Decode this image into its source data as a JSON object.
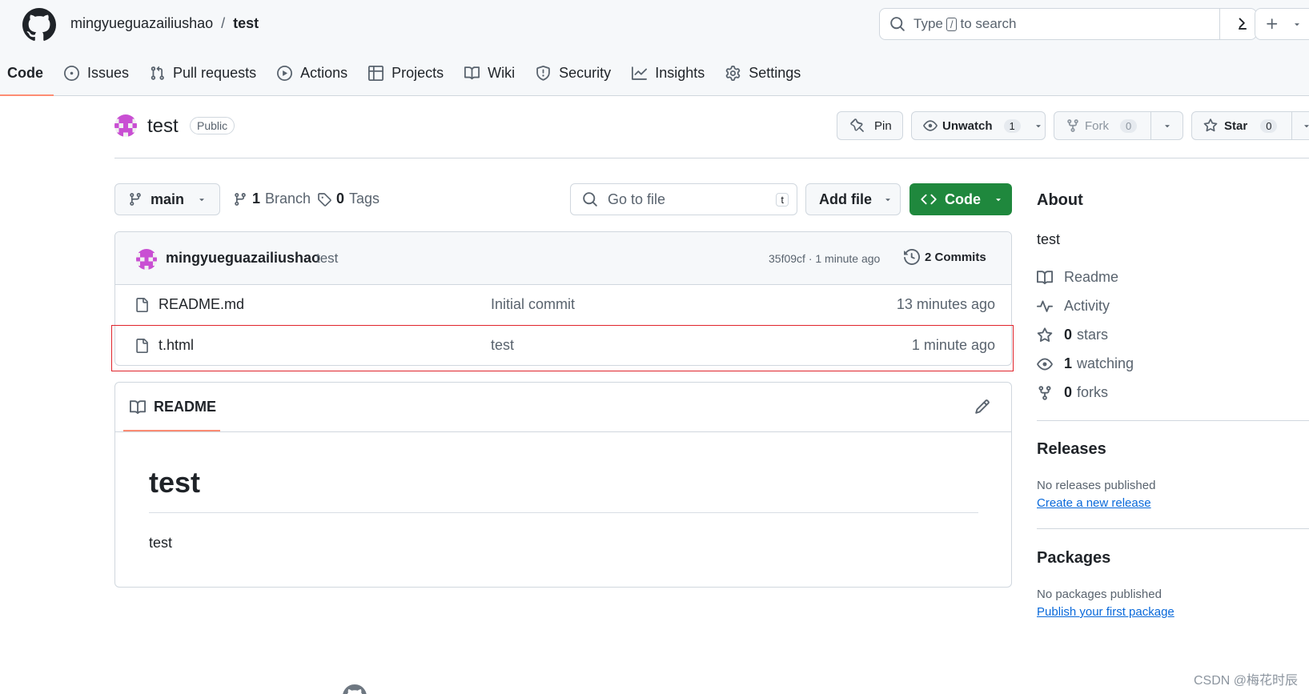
{
  "header": {
    "owner": "mingyueguazailiushao",
    "separator": "/",
    "repo": "test",
    "search_prefix": "Type",
    "search_key": "/",
    "search_suffix": "to search"
  },
  "tabs": [
    {
      "label": "Code",
      "icon": "code-icon",
      "active": true
    },
    {
      "label": "Issues",
      "icon": "issue-icon"
    },
    {
      "label": "Pull requests",
      "icon": "pull-request-icon"
    },
    {
      "label": "Actions",
      "icon": "play-icon"
    },
    {
      "label": "Projects",
      "icon": "table-icon"
    },
    {
      "label": "Wiki",
      "icon": "book-icon"
    },
    {
      "label": "Security",
      "icon": "shield-icon"
    },
    {
      "label": "Insights",
      "icon": "graph-icon"
    },
    {
      "label": "Settings",
      "icon": "gear-icon"
    }
  ],
  "repo_header": {
    "title": "test",
    "visibility": "Public",
    "pin_label": "Pin",
    "unwatch_label": "Unwatch",
    "watch_count": "1",
    "fork_label": "Fork",
    "fork_count": "0",
    "star_label": "Star",
    "star_count": "0"
  },
  "toolbar": {
    "branch": "main",
    "branch_count": "1",
    "branch_label": "Branch",
    "tag_count": "0",
    "tag_label": "Tags",
    "go_to_file_placeholder": "Go to file",
    "go_to_file_key": "t",
    "add_file_label": "Add file",
    "code_label": "Code"
  },
  "latest_commit": {
    "author": "mingyueguazailiushao",
    "message": "test",
    "hash_time": "35f09cf · 1 minute ago",
    "commits_label": "2 Commits"
  },
  "files": [
    {
      "name": "README.md",
      "message": "Initial commit",
      "date": "13 minutes ago"
    },
    {
      "name": "t.html",
      "message": "test",
      "date": "1 minute ago"
    }
  ],
  "readme": {
    "tab_label": "README",
    "heading": "test",
    "body": "test"
  },
  "sidebar": {
    "about_title": "About",
    "description": "test",
    "readme_label": "Readme",
    "activity_label": "Activity",
    "stars_count": "0",
    "stars_label": "stars",
    "watching_count": "1",
    "watching_label": "watching",
    "forks_count": "0",
    "forks_label": "forks",
    "releases_title": "Releases",
    "releases_empty": "No releases published",
    "releases_link": "Create a new release",
    "packages_title": "Packages",
    "packages_empty": "No packages published",
    "packages_link": "Publish your first package"
  },
  "watermark": "CSDN @梅花时辰",
  "colors": {
    "accent_underline": "#fd8c73",
    "code_button": "#1f883d",
    "link": "#0969da",
    "highlight_box": "#e0242b"
  }
}
